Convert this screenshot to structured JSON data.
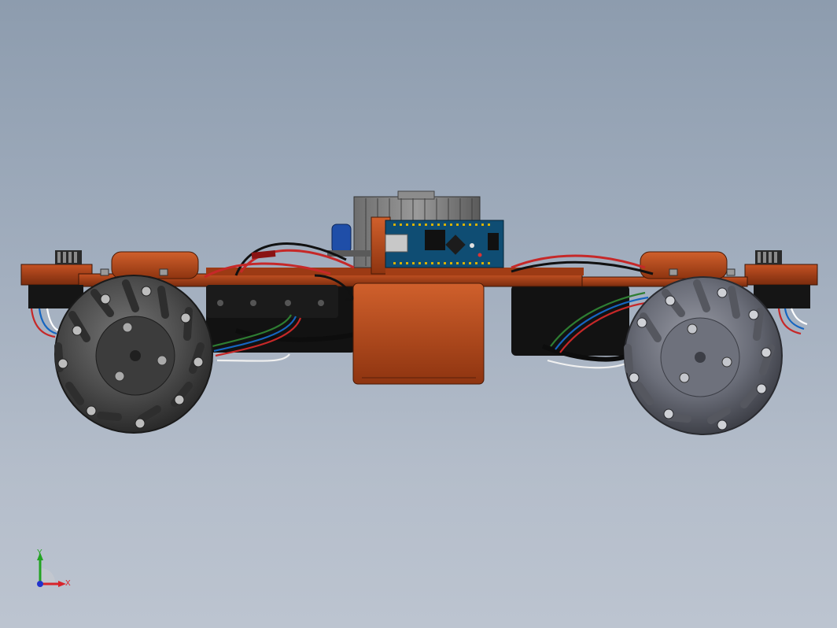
{
  "viewport": {
    "background_top": "#8d9cae",
    "background_bottom": "#bcc4d0"
  },
  "model": {
    "chassis_color": "#b5461c",
    "wheel_left_color": "#4d4d4d",
    "wheel_right_color": "#6a6d78",
    "controller_board_color": "#0f4d73",
    "wire_colors": [
      "#c62828",
      "#2e7d32",
      "#1565c0",
      "#101010",
      "#ffffff"
    ]
  },
  "triad": {
    "y_label": "Y",
    "x_label": "X",
    "y_color": "#22a322",
    "x_color": "#d8242b",
    "z_color": "#2233cc"
  }
}
